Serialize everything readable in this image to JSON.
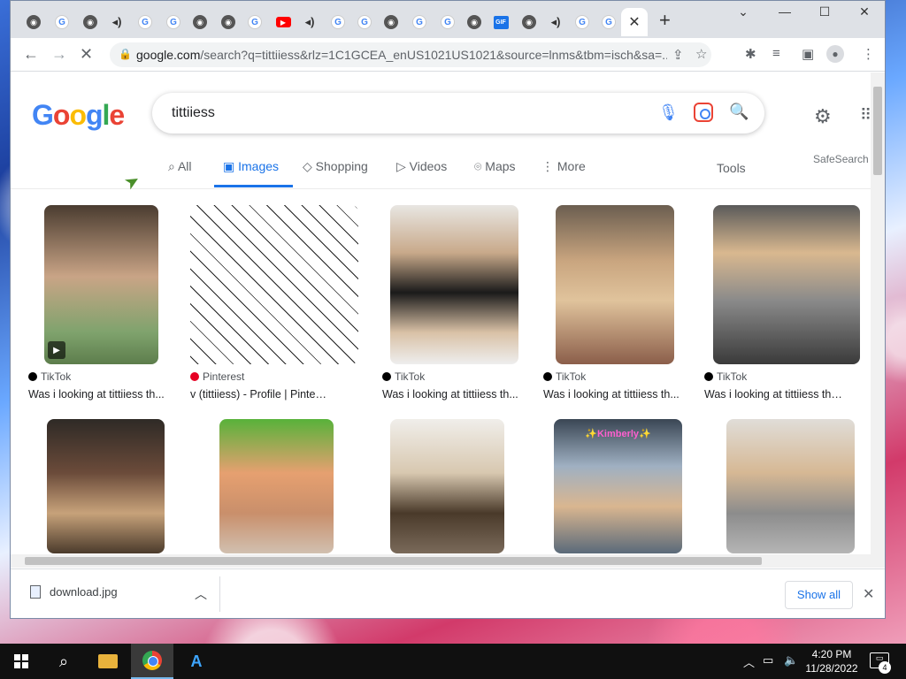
{
  "browser": {
    "tabs": [
      {
        "icon": "chrome-icon",
        "type": "c"
      },
      {
        "icon": "google-icon",
        "type": "g"
      },
      {
        "icon": "chrome-icon",
        "type": "c"
      },
      {
        "icon": "speaker-icon",
        "type": "s"
      },
      {
        "icon": "google-icon",
        "type": "g"
      },
      {
        "icon": "google-icon",
        "type": "g"
      },
      {
        "icon": "chrome-icon",
        "type": "c"
      },
      {
        "icon": "chrome-icon",
        "type": "c"
      },
      {
        "icon": "google-icon",
        "type": "g"
      },
      {
        "icon": "youtube-icon",
        "type": "y"
      },
      {
        "icon": "speaker-icon",
        "type": "s"
      },
      {
        "icon": "google-icon",
        "type": "g"
      },
      {
        "icon": "google-icon",
        "type": "g"
      },
      {
        "icon": "chrome-icon",
        "type": "c"
      },
      {
        "icon": "google-icon",
        "type": "g"
      },
      {
        "icon": "google-icon",
        "type": "g"
      },
      {
        "icon": "chrome-icon",
        "type": "c"
      },
      {
        "icon": "gif-icon",
        "type": "gif",
        "label": "GIF"
      },
      {
        "icon": "chrome-icon",
        "type": "c"
      },
      {
        "icon": "speaker-icon",
        "type": "s"
      },
      {
        "icon": "google-icon",
        "type": "g"
      },
      {
        "icon": "google-icon",
        "type": "g"
      }
    ],
    "new_tab": "+",
    "url_host": "google.com",
    "url_rest": "/search?q=tittiiess&rlz=1C1GCEA_enUS1021US1021&source=lnms&tbm=isch&sa=..."
  },
  "search": {
    "logo": [
      "G",
      "o",
      "o",
      "g",
      "l",
      "e"
    ],
    "query": "tittiiess",
    "tabs": [
      "All",
      "Images",
      "Shopping",
      "Videos",
      "Maps",
      "More"
    ],
    "tab_icons": [
      "search-icon",
      "images-icon",
      "tag-icon",
      "video-icon",
      "map-pin-icon",
      "more-vert-icon"
    ],
    "active_tab": "Images",
    "tools": "Tools",
    "safesearch": "SafeSearch"
  },
  "results": [
    {
      "source": "TikTok",
      "title": "Was i looking at tittiiess th...",
      "src_type": "tiktok",
      "video": true
    },
    {
      "source": "Pinterest",
      "title": "v (tittiiess) - Profile | Pinterest",
      "src_type": "pinterest"
    },
    {
      "source": "TikTok",
      "title": "Was i looking at tittiiess th...",
      "src_type": "tiktok"
    },
    {
      "source": "TikTok",
      "title": "Was i looking at tittiiess th...",
      "src_type": "tiktok"
    },
    {
      "source": "TikTok",
      "title": "Was i looking at tittiiess tho? ...",
      "src_type": "tiktok"
    },
    {
      "source": "",
      "title": ""
    },
    {
      "source": "",
      "title": ""
    },
    {
      "source": "",
      "title": ""
    },
    {
      "source": "",
      "title": "",
      "overlay": "✨Kimberly✨"
    },
    {
      "source": "",
      "title": ""
    }
  ],
  "download": {
    "filename": "download.jpg",
    "show_all": "Show all"
  },
  "taskbar": {
    "time": "4:20 PM",
    "date": "11/28/2022",
    "notifications": "4"
  }
}
